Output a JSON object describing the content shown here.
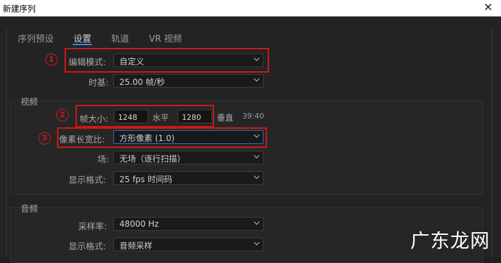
{
  "window": {
    "title": "新建序列",
    "close_glyph": "✕"
  },
  "tabs": [
    {
      "label": "序列预设",
      "active": false
    },
    {
      "label": "设置",
      "active": true
    },
    {
      "label": "轨道",
      "active": false
    },
    {
      "label": "VR 视频",
      "active": false
    }
  ],
  "settings": {
    "edit_mode_label": "编辑模式:",
    "edit_mode_value": "自定义",
    "timebase_label": "时基:",
    "timebase_value": "25.00  帧/秒"
  },
  "video": {
    "section_title": "视频",
    "frame_size_label": "帧大小:",
    "frame_width": "1248",
    "horizontal_label": "水平",
    "frame_height": "1280",
    "vertical_label": "垂直",
    "aspect": "39:40",
    "pixel_aspect_label": "像素长宽比:",
    "pixel_aspect_value": "方形像素 (1.0)",
    "fields_label": "场:",
    "fields_value": "无场（逐行扫描）",
    "display_format_label": "显示格式:",
    "display_format_value": "25 fps 时间码"
  },
  "audio": {
    "section_title": "音频",
    "sample_rate_label": "采样率:",
    "sample_rate_value": "48000 Hz",
    "display_format_label": "显示格式:",
    "display_format_value": "音频采样"
  },
  "annotations": {
    "marker_1": "1",
    "marker_2": "2",
    "marker_3": "3",
    "highlight_color": "#d01818"
  },
  "watermark": "广东龙网",
  "colors": {
    "accent": "#2d8ceb",
    "background": "#232323"
  }
}
